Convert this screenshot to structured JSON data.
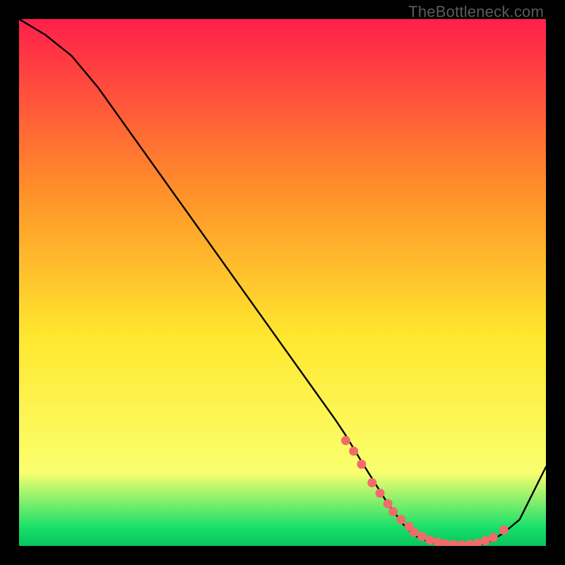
{
  "watermark": "TheBottleneck.com",
  "gradient": {
    "top_color": "#ff1f4a",
    "mid_upper": "#ff8e2a",
    "mid": "#ffe72e",
    "mid_lower": "#faff6e",
    "green": "#18e06a",
    "bottom_color": "#07c45c"
  },
  "curve_color": "#000000",
  "marker_color": "#f26b6b",
  "chart_data": {
    "type": "line",
    "title": "",
    "xlabel": "",
    "ylabel": "",
    "xlim": [
      0,
      100
    ],
    "ylim": [
      0,
      100
    ],
    "series": [
      {
        "name": "bottleneck-curve",
        "x": [
          0,
          5,
          10,
          15,
          20,
          25,
          30,
          35,
          40,
          45,
          50,
          55,
          60,
          62,
          65,
          70,
          73,
          75,
          78,
          80,
          82,
          85,
          88,
          90,
          92,
          95,
          100
        ],
        "y": [
          100,
          97,
          93,
          87,
          80,
          73,
          66,
          59,
          52,
          45,
          38,
          31,
          24,
          21,
          16,
          8,
          4,
          2,
          0.7,
          0.3,
          0.2,
          0.2,
          0.4,
          1.2,
          2.5,
          5,
          15
        ]
      }
    ],
    "markers": {
      "name": "highlight-dots",
      "x": [
        62,
        63.5,
        65,
        67,
        68.5,
        70,
        71,
        72.5,
        74,
        75,
        76.5,
        78,
        79.5,
        81,
        82.5,
        84,
        85.5,
        87,
        88.5,
        90,
        92
      ],
      "y": [
        20,
        18,
        15.5,
        12,
        10,
        8,
        6.5,
        5,
        3.7,
        2.6,
        1.8,
        1.1,
        0.7,
        0.4,
        0.25,
        0.2,
        0.25,
        0.5,
        1.0,
        1.6,
        3.0
      ]
    }
  }
}
